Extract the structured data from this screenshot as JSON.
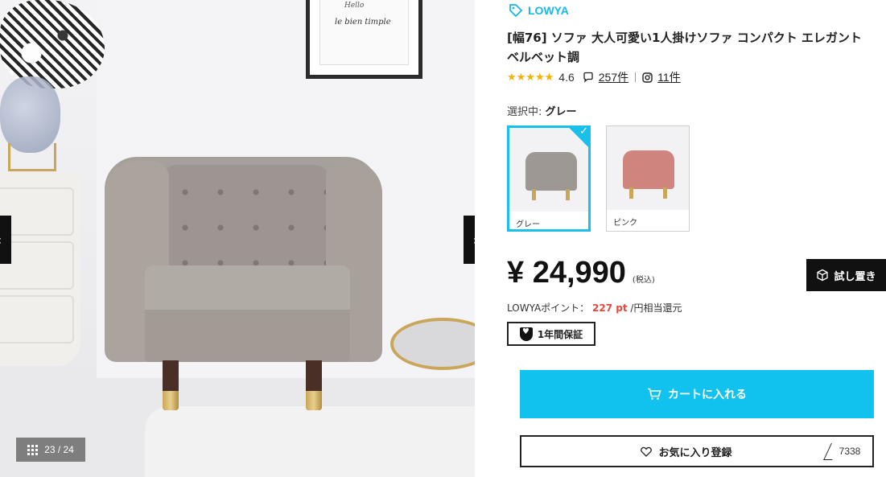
{
  "gallery": {
    "counter": "23 / 24",
    "frame_text_1": "Hello",
    "frame_text_2": "le bien timple"
  },
  "product": {
    "brand": "LOWYA",
    "title": "[幅76] ソファ 大人可愛い1人掛けソファ コンパクト エレガント ベルベット調",
    "rating": {
      "stars": "★★★★★",
      "score": "4.6",
      "reviews": "257件",
      "posts": "11件"
    },
    "selected_label": "選択中:",
    "selected_value": "グレー",
    "variants": [
      {
        "label": "グレー",
        "selected": true,
        "color": "#9e9894"
      },
      {
        "label": "ピンク",
        "selected": false,
        "color": "#d0847e"
      }
    ],
    "price": "¥ 24,990",
    "tax_note": "(税込)",
    "trial_button": "試し置き",
    "points_label": "LOWYAポイント：",
    "points_value": "227 pt",
    "points_suffix": "/円相当還元",
    "warranty": "1年間保証",
    "cart_button": "カートに入れる",
    "favorite_button": "お気に入り登録",
    "favorite_count": "7338"
  },
  "colors": {
    "accent": "#19c0ea",
    "cart": "#12c2ee",
    "points": "#e8473c"
  }
}
